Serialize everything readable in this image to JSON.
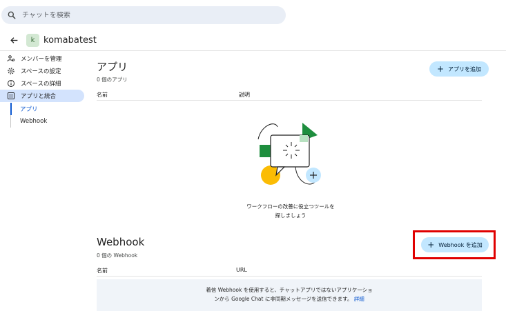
{
  "search": {
    "placeholder": "チャットを検索",
    "icon": "search-icon"
  },
  "space": {
    "avatar_letter": "k",
    "name": "komabatest"
  },
  "sidebar": {
    "items": [
      {
        "label": "メンバーを管理",
        "icon": "people-settings-icon"
      },
      {
        "label": "スペースの設定",
        "icon": "gear-icon"
      },
      {
        "label": "スペースの詳細",
        "icon": "info-icon"
      },
      {
        "label": "アプリと統合",
        "icon": "apps-grid-icon",
        "active": true
      }
    ],
    "sub_items": [
      {
        "label": "アプリ",
        "active": true
      },
      {
        "label": "Webhook",
        "active": false
      }
    ]
  },
  "apps": {
    "title": "アプリ",
    "count": "0 個のアプリ",
    "add_label": "アプリを追加",
    "col_name": "名前",
    "col_description": "説明",
    "empty_line1": "ワークフローの改善に役立つツールを",
    "empty_line2": "探しましょう"
  },
  "webhook": {
    "title": "Webhook",
    "count": "0 個の Webhook",
    "add_label": "Webhook を追加",
    "col_name": "名前",
    "col_url": "URL",
    "info_line1": "着信 Webhook を使用すると、チャットアプリではないアプリケーショ",
    "info_line2": "ンから Google Chat に非同期メッセージを送信できます。",
    "detail_link": "詳細"
  },
  "colors": {
    "accent": "#0b57d0",
    "button_bg": "#c2e7ff",
    "active_nav": "#d3e3fd",
    "highlight": "#e00000"
  }
}
